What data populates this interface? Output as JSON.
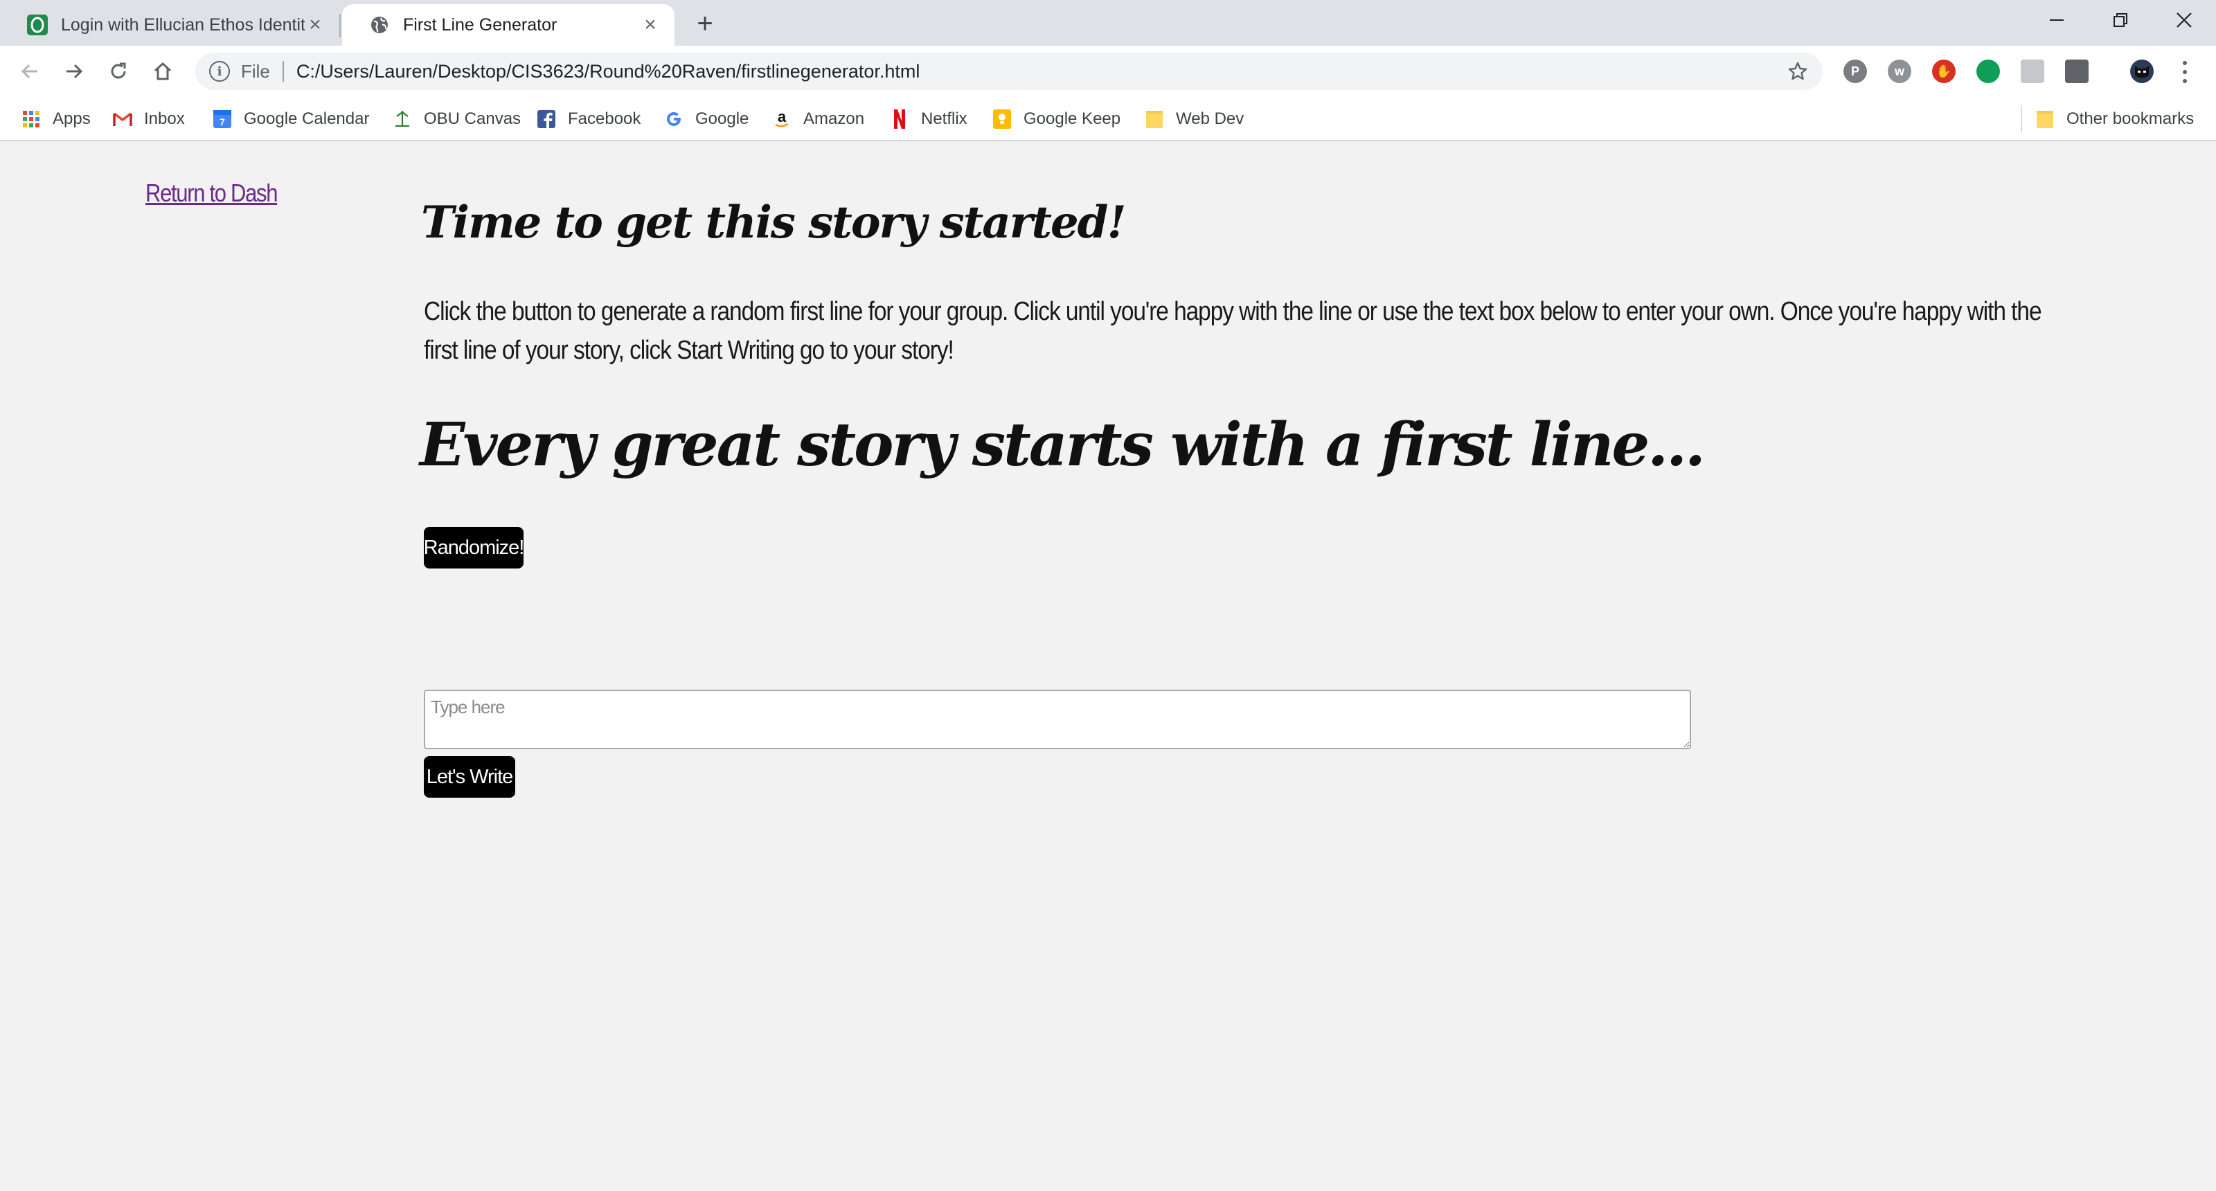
{
  "browser": {
    "tabs": [
      {
        "title": "Login with Ellucian Ethos Identity",
        "active": false,
        "icon": "ellucian-logo-icon"
      },
      {
        "title": "First Line Generator",
        "active": true,
        "icon": "globe-icon"
      }
    ],
    "address": {
      "scheme_label": "File",
      "url": "C:/Users/Lauren/Desktop/CIS3623/Round%20Raven/firstlinegenerator.html"
    },
    "extensions": [
      "pinterest-icon",
      "w-extension-icon",
      "adblock-icon",
      "green-extension-icon",
      "grey-extension-icon",
      "keep-extension-icon",
      "profile-avatar-icon"
    ],
    "bookmarks": [
      {
        "label": "Apps",
        "icon": "apps-grid-icon"
      },
      {
        "label": "Inbox",
        "icon": "gmail-icon"
      },
      {
        "label": "Google Calendar",
        "icon": "calendar-icon"
      },
      {
        "label": "OBU Canvas",
        "icon": "canvas-icon"
      },
      {
        "label": "Facebook",
        "icon": "facebook-icon"
      },
      {
        "label": "Google",
        "icon": "google-icon"
      },
      {
        "label": "Amazon",
        "icon": "amazon-icon"
      },
      {
        "label": "Netflix",
        "icon": "netflix-icon"
      },
      {
        "label": "Google Keep",
        "icon": "keep-icon"
      },
      {
        "label": "Web Dev",
        "icon": "folder-icon"
      }
    ],
    "other_bookmarks": "Other bookmarks"
  },
  "page": {
    "return_link": "Return to Dash",
    "heading1": "Time to get this story started!",
    "intro": "Click the button to generate a random first line for your group. Click until you're happy with the line or use the text box below to enter your own. Once you're happy with the first line of your story, click Start Writing go to your story!",
    "heading2": "Every great story starts with a first line...",
    "randomize_button": "Randomize!",
    "textbox_placeholder": "Type here",
    "textbox_value": "",
    "write_button": "Let's Write"
  },
  "colors": {
    "page_background": "#f1f2f1",
    "button_background": "#000000",
    "link_visited": "#6a2a8a",
    "tabstrip": "#dee1e6"
  }
}
